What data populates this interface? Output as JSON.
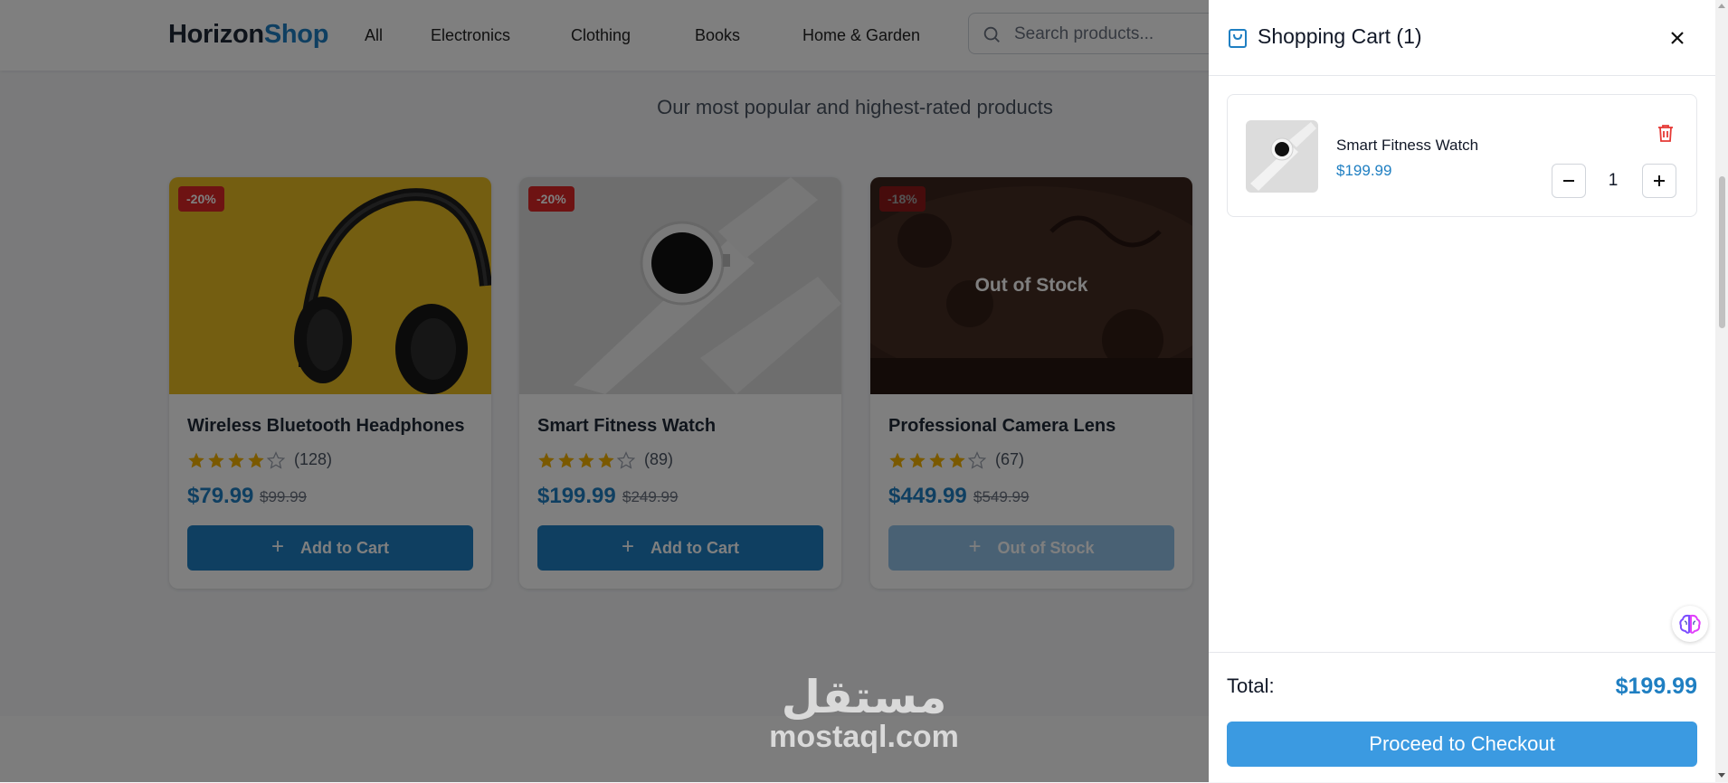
{
  "header": {
    "logo_part1": "Horizon",
    "logo_part2": "Shop",
    "nav": [
      "All",
      "Electronics",
      "Clothing",
      "Books",
      "Home & Garden"
    ],
    "search_placeholder": "Search products..."
  },
  "section": {
    "subtitle": "Our most popular and highest-rated products"
  },
  "products": [
    {
      "badge": "-20%",
      "title": "Wireless Bluetooth Headphones",
      "rating": 4,
      "review_count": "(128)",
      "price": "$79.99",
      "old_price": "$99.99",
      "button": "Add to Cart",
      "in_stock": true
    },
    {
      "badge": "-20%",
      "title": "Smart Fitness Watch",
      "rating": 4,
      "review_count": "(89)",
      "price": "$199.99",
      "old_price": "$249.99",
      "button": "Add to Cart",
      "in_stock": true
    },
    {
      "badge": "-18%",
      "title": "Professional Camera Lens",
      "rating": 4,
      "review_count": "(67)",
      "price": "$449.99",
      "old_price": "$549.99",
      "button": "Out of Stock",
      "in_stock": false,
      "overlay": "Out of Stock"
    }
  ],
  "cart": {
    "title": "Shopping Cart (1)",
    "items": [
      {
        "name": "Smart Fitness Watch",
        "price": "$199.99",
        "quantity": "1"
      }
    ],
    "total_label": "Total:",
    "total_value": "$199.99",
    "checkout_label": "Proceed to Checkout"
  },
  "watermark": {
    "arabic": "مستقل",
    "latin": "mostaql.com"
  },
  "colors": {
    "brand": "#1f7fc2",
    "discount_badge": "#dc2626",
    "checkout": "#3b9ae1",
    "star": "#f5b301"
  },
  "icons": [
    "search-icon",
    "star-icon",
    "plus-icon",
    "shopping-bag-icon",
    "close-icon",
    "trash-icon",
    "minus-icon",
    "brain-icon"
  ]
}
